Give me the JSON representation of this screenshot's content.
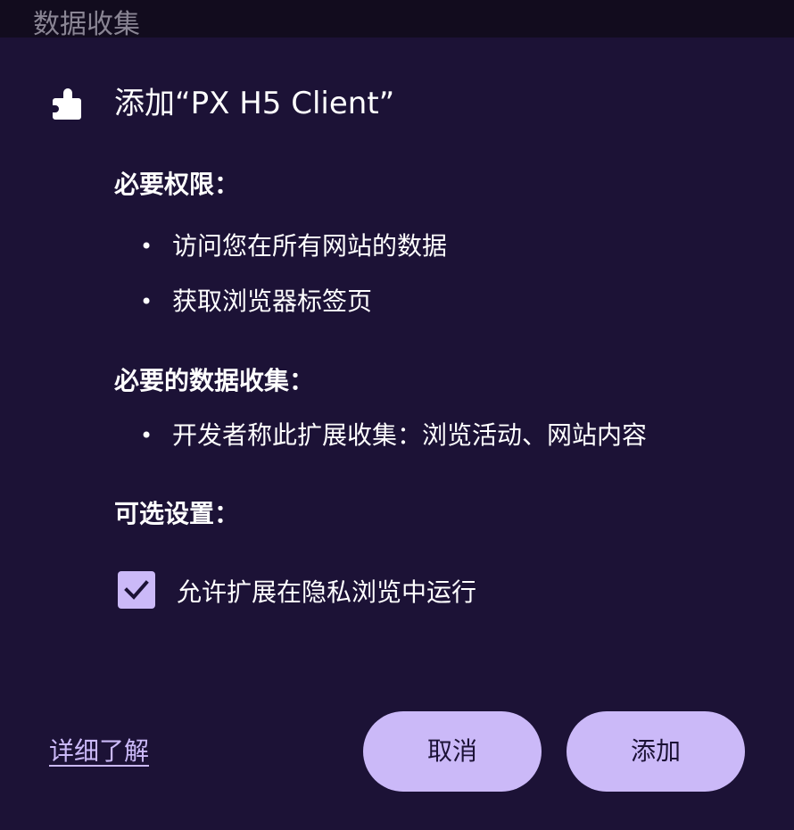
{
  "background": {
    "title": "数据收集"
  },
  "dialog": {
    "icon": "puzzle-icon",
    "title": "添加“PX H5 Client”",
    "required_permissions": {
      "heading": "必要权限：",
      "items": [
        "访问您在所有网站的数据",
        "获取浏览器标签页"
      ]
    },
    "required_data_collection": {
      "heading": "必要的数据收集：",
      "items": [
        "开发者称此扩展收集：浏览活动、网站内容"
      ]
    },
    "optional_settings": {
      "heading": "可选设置：",
      "checkbox_label": "允许扩展在隐私浏览中运行",
      "checkbox_checked": true,
      "checkbox_icon": "checkmark-icon"
    },
    "footer": {
      "learn_more": "详细了解",
      "cancel_label": "取消",
      "add_label": "添加"
    }
  },
  "colors": {
    "dialog_background": "#1c1236",
    "header_background": "#120c1e",
    "accent": "#cbb9f8",
    "button_text": "#1c1236",
    "text": "#ffffff",
    "muted_text": "#8a8594"
  }
}
